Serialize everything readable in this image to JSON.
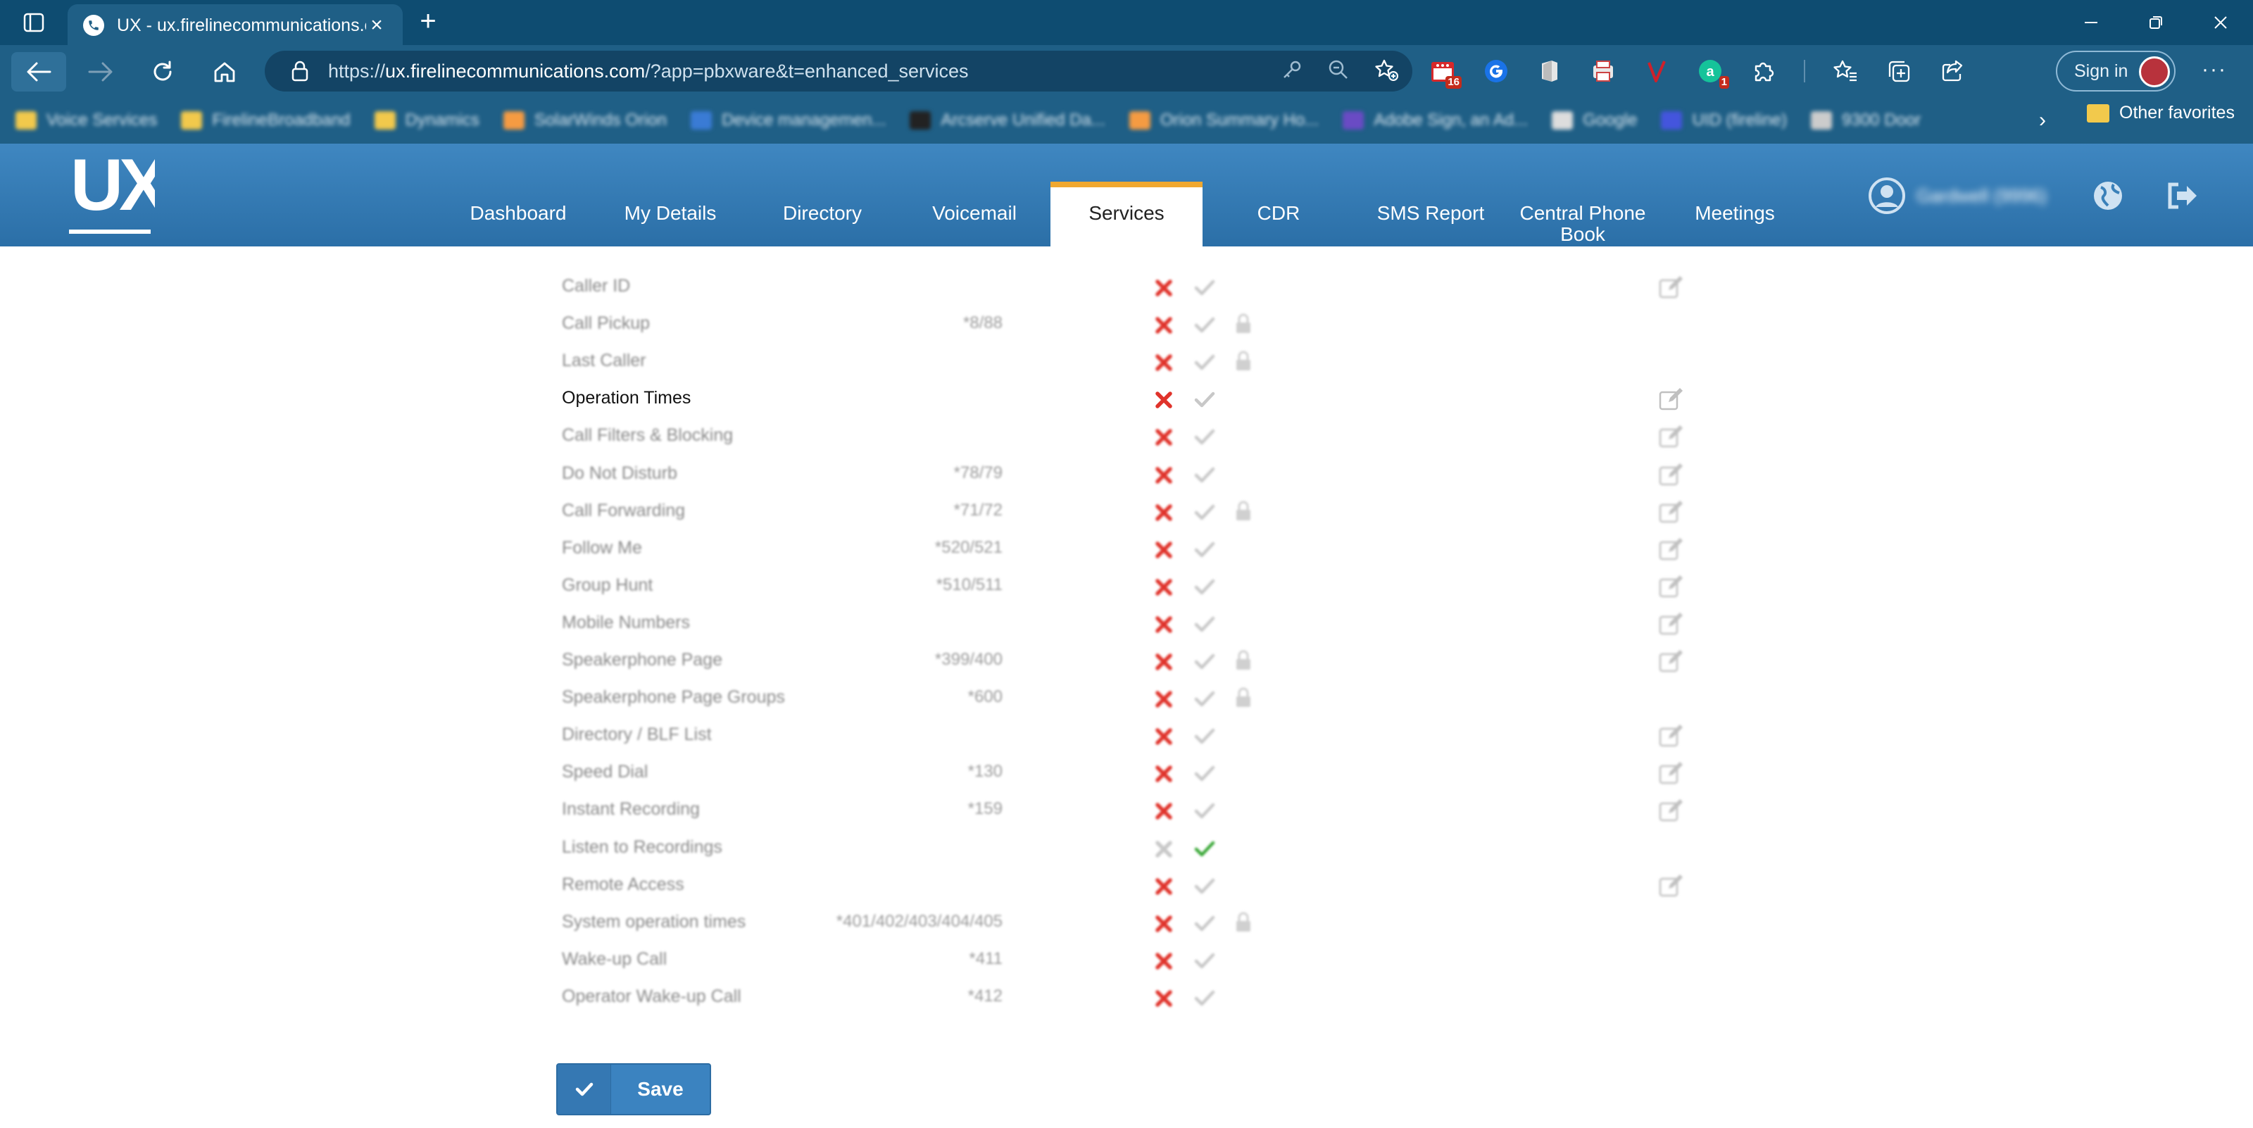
{
  "browser": {
    "tab_title": "UX - ux.firelinecommunications.c",
    "url_prefix": "https://",
    "url_host": "ux.firelinecommunications.com",
    "url_path": "/?app=pbxware&t=enhanced_services",
    "extension_badges": {
      "calendar": "16",
      "grammarly": "1"
    },
    "signin_label": "Sign in",
    "bookmarks": [
      {
        "label": "Voice Services",
        "color": "#f2c94c"
      },
      {
        "label": "FirelineBroadband",
        "color": "#f2c94c"
      },
      {
        "label": "Dynamics",
        "color": "#f2c94c"
      },
      {
        "label": "SolarWinds Orion",
        "color": "#f59b42"
      },
      {
        "label": "Device managemen...",
        "color": "#3a7bd5"
      },
      {
        "label": "Arcserve Unified Da...",
        "color": "#222222"
      },
      {
        "label": "Orion Summary Ho...",
        "color": "#f59b42"
      },
      {
        "label": "Adobe Sign, an Ad...",
        "color": "#6a4bc4"
      },
      {
        "label": "Google",
        "color": "#dddddd"
      },
      {
        "label": "UID (fireline)",
        "color": "#4455dd"
      },
      {
        "label": "9300 Door",
        "color": "#cccccc"
      }
    ],
    "other_favorites": "Other favorites"
  },
  "app": {
    "logo_text": "UX",
    "nav": [
      {
        "label": "Dashboard",
        "active": false
      },
      {
        "label": "My Details",
        "active": false
      },
      {
        "label": "Directory",
        "active": false
      },
      {
        "label": "Voicemail",
        "active": false
      },
      {
        "label": "Services",
        "active": true
      },
      {
        "label": "CDR",
        "active": false
      },
      {
        "label": "SMS Report",
        "active": false
      },
      {
        "label": "Central Phone Book",
        "active": false
      },
      {
        "label": "Meetings",
        "active": false
      }
    ],
    "user_name": "Gardwell (9996)"
  },
  "services": [
    {
      "name": "Caller ID",
      "code": "",
      "state": "off",
      "lock": false,
      "edit": true,
      "active": false
    },
    {
      "name": "Call Pickup",
      "code": "*8/88",
      "state": "off",
      "lock": true,
      "edit": false,
      "active": false
    },
    {
      "name": "Last Caller",
      "code": "",
      "state": "off",
      "lock": true,
      "edit": false,
      "active": false
    },
    {
      "name": "Operation Times",
      "code": "",
      "state": "off",
      "lock": false,
      "edit": true,
      "active": true
    },
    {
      "name": "Call Filters & Blocking",
      "code": "",
      "state": "off",
      "lock": false,
      "edit": true,
      "active": false
    },
    {
      "name": "Do Not Disturb",
      "code": "*78/79",
      "state": "off",
      "lock": false,
      "edit": true,
      "active": false
    },
    {
      "name": "Call Forwarding",
      "code": "*71/72",
      "state": "off",
      "lock": true,
      "edit": true,
      "active": false
    },
    {
      "name": "Follow Me",
      "code": "*520/521",
      "state": "off",
      "lock": false,
      "edit": true,
      "active": false
    },
    {
      "name": "Group Hunt",
      "code": "*510/511",
      "state": "off",
      "lock": false,
      "edit": true,
      "active": false
    },
    {
      "name": "Mobile Numbers",
      "code": "",
      "state": "off",
      "lock": false,
      "edit": true,
      "active": false
    },
    {
      "name": "Speakerphone Page",
      "code": "*399/400",
      "state": "off",
      "lock": true,
      "edit": true,
      "active": false
    },
    {
      "name": "Speakerphone Page Groups",
      "code": "*600",
      "state": "off",
      "lock": true,
      "edit": false,
      "active": false
    },
    {
      "name": "Directory / BLF List",
      "code": "",
      "state": "off",
      "lock": false,
      "edit": true,
      "active": false
    },
    {
      "name": "Speed Dial",
      "code": "*130",
      "state": "off",
      "lock": false,
      "edit": true,
      "active": false
    },
    {
      "name": "Instant Recording",
      "code": "*159",
      "state": "off",
      "lock": false,
      "edit": true,
      "active": false
    },
    {
      "name": "Listen to Recordings",
      "code": "",
      "state": "on",
      "lock": false,
      "edit": false,
      "active": false
    },
    {
      "name": "Remote Access",
      "code": "",
      "state": "off",
      "lock": false,
      "edit": true,
      "active": false
    },
    {
      "name": "System operation times",
      "code": "*401/402/403/404/405",
      "state": "off",
      "lock": true,
      "edit": false,
      "active": false
    },
    {
      "name": "Wake-up Call",
      "code": "*411",
      "state": "off",
      "lock": false,
      "edit": false,
      "active": false
    },
    {
      "name": "Operator Wake-up Call",
      "code": "*412",
      "state": "off",
      "lock": false,
      "edit": false,
      "active": false
    }
  ],
  "save_label": "Save",
  "colors": {
    "x_active": "#e0332b",
    "x_inactive": "#c8c8c8",
    "check_active": "#3ba838",
    "check_inactive": "#c8c8c8",
    "accent": "#f0a830",
    "header": "#3f87c1"
  }
}
